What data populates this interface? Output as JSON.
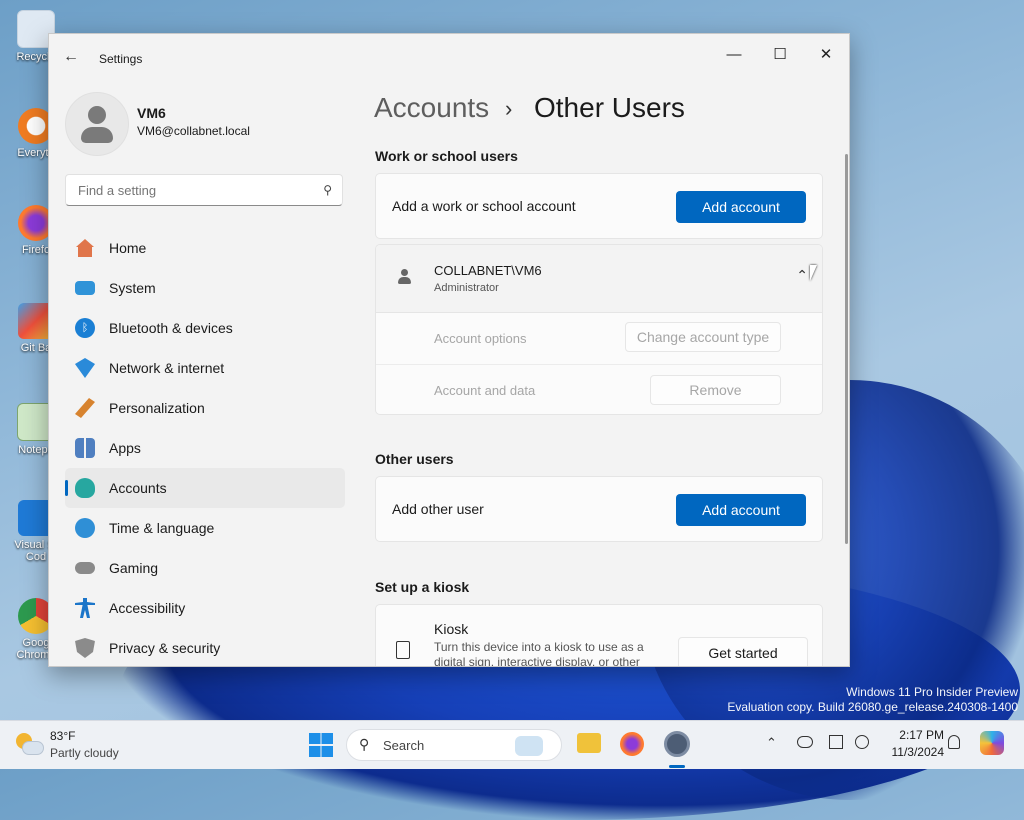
{
  "desktop": {
    "icons": [
      {
        "label": "Recycle",
        "name": "recycle-bin-icon"
      },
      {
        "label": "Everyth",
        "name": "everything-app-icon"
      },
      {
        "label": "Firefo",
        "name": "firefox-desktop-icon"
      },
      {
        "label": "Git Ba",
        "name": "git-bash-icon"
      },
      {
        "label": "Notepa",
        "name": "notepad-desktop-icon"
      },
      {
        "label": "Visual St Cod",
        "name": "vscode-desktop-icon"
      },
      {
        "label": "Goog Chrome",
        "name": "chrome-desktop-icon"
      }
    ],
    "watermark_line1": "Windows 11 Pro Insider Preview",
    "watermark_line2": "Evaluation copy. Build 26080.ge_release.240308-1400"
  },
  "window": {
    "title": "Settings",
    "back_icon": "arrow-left-icon",
    "min_label": "—",
    "max_label": "☐",
    "close_label": "✕"
  },
  "profile": {
    "name": "VM6",
    "email": "VM6@collabnet.local"
  },
  "search": {
    "placeholder": "Find a setting"
  },
  "sidebar": {
    "items": [
      {
        "label": "Home",
        "icon": "home-icon",
        "color": "#e0754a"
      },
      {
        "label": "System",
        "icon": "system-display-icon",
        "color": "#2f93d8"
      },
      {
        "label": "Bluetooth & devices",
        "icon": "bluetooth-icon",
        "color": "#1a7fd4"
      },
      {
        "label": "Network & internet",
        "icon": "wifi-icon",
        "color": "#2a8ad9"
      },
      {
        "label": "Personalization",
        "icon": "brush-icon",
        "color": "#d7832f"
      },
      {
        "label": "Apps",
        "icon": "apps-icon",
        "color": "#4f7fc0"
      },
      {
        "label": "Accounts",
        "icon": "person-icon",
        "color": "#27a7a0"
      },
      {
        "label": "Time & language",
        "icon": "globe-clock-icon",
        "color": "#2f8fd6"
      },
      {
        "label": "Gaming",
        "icon": "controller-icon",
        "color": "#8a8a8a"
      },
      {
        "label": "Accessibility",
        "icon": "accessibility-icon",
        "color": "#1b75c9"
      },
      {
        "label": "Privacy & security",
        "icon": "shield-icon",
        "color": "#8b8b8b"
      }
    ],
    "selected": "Accounts"
  },
  "main": {
    "breadcrumb_parent": "Accounts",
    "breadcrumb_sep": "›",
    "breadcrumb_current": "Other Users",
    "work_section_title": "Work or school users",
    "work_add_label": "Add a work or school account",
    "work_add_button": "Add account",
    "account_name": "COLLABNET\\VM6",
    "account_role": "Administrator",
    "account_options_label": "Account options",
    "change_type_button": "Change account type",
    "account_data_label": "Account and data",
    "remove_button": "Remove",
    "other_section_title": "Other users",
    "other_add_label": "Add other user",
    "other_add_button": "Add account",
    "kiosk_section_title": "Set up a kiosk",
    "kiosk_title": "Kiosk",
    "kiosk_desc": "Turn this device into a kiosk to use as a digital sign, interactive display, or other",
    "kiosk_button": "Get started"
  },
  "taskbar": {
    "weather_temp": "83°F",
    "weather_desc": "Partly cloudy",
    "search_label": "Search",
    "time": "2:17 PM",
    "date": "11/3/2024"
  }
}
